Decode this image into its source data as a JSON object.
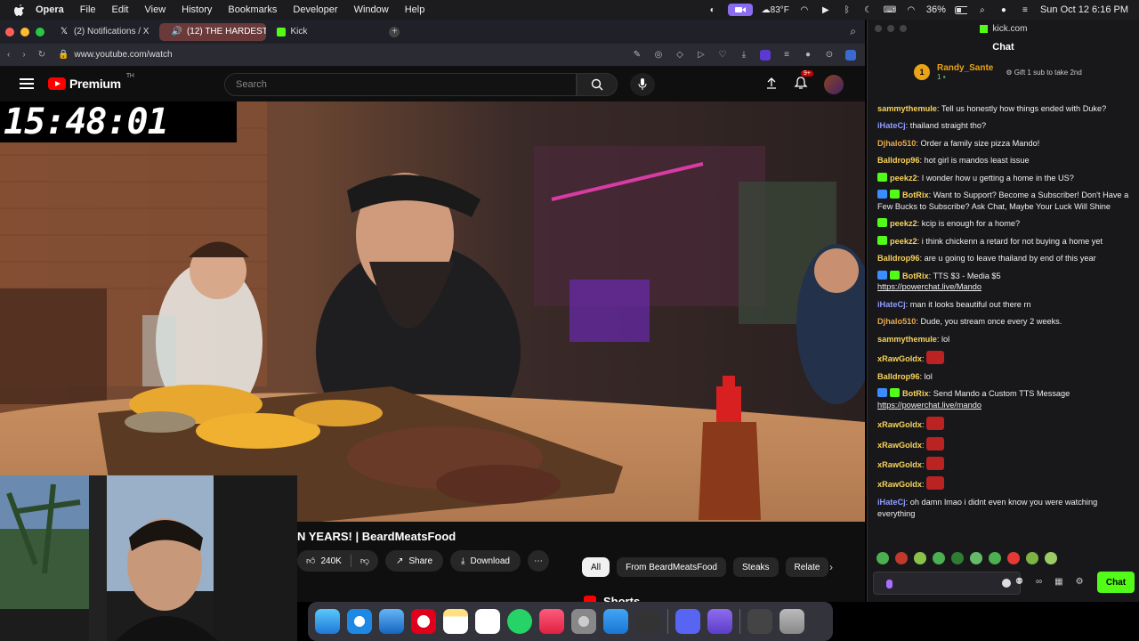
{
  "menubar": {
    "app_name": "Opera",
    "items": [
      "File",
      "Edit",
      "View",
      "History",
      "Bookmarks",
      "Developer",
      "Window",
      "Help"
    ],
    "weather": "83°F",
    "battery": "36%",
    "clock": "Sun Oct 12  6:16 PM"
  },
  "browser": {
    "tabs": [
      {
        "label": "(2) Notifications / X",
        "icon": "x-icon"
      },
      {
        "label": "(12) THE HARDEST",
        "icon": "youtube-icon"
      },
      {
        "label": "Kick",
        "icon": "kick-icon"
      }
    ],
    "url": "www.youtube.com/watch"
  },
  "youtube": {
    "logo_text": "Premium",
    "logo_sup": "TH",
    "search_placeholder": "Search",
    "notif_count": "9+",
    "video_title": "N YEARS! | BeardMeatsFood",
    "likes": "240K",
    "share_label": "Share",
    "download_label": "Download",
    "chips": [
      "All",
      "From BeardMeatsFood",
      "Steaks",
      "Relate"
    ],
    "shorts_label": "Shorts"
  },
  "overlay": {
    "timer": "15:48:01"
  },
  "chat": {
    "site": "kick.com",
    "title": "Chat",
    "pinned_user": "Randy_Sante",
    "pinned_rank": "1",
    "pinned_sub": "1",
    "gift_text": "Gift 1 sub to take 2nd",
    "messages": [
      {
        "user": "sammythemule",
        "color": "#f7d35a",
        "text": "Tell us honestly how things ended with Duke?"
      },
      {
        "user": "iHateCj",
        "color": "#8f9dff",
        "text": "thailand straight tho?"
      },
      {
        "user": "Djhalo510",
        "color": "#e8a94a",
        "text": "Order a family size pizza Mando!"
      },
      {
        "user": "Balldrop96",
        "color": "#f7d35a",
        "text": "hot girl is mandos least issue"
      },
      {
        "user": "peekz2",
        "color": "#f7d35a",
        "text": "I wonder how u getting a home in the US?",
        "badges": [
          "#53fc18"
        ]
      },
      {
        "user": "BotRix",
        "color": "#f7d35a",
        "text": "Want to Support? Become a Subscriber! Don't Have a Few Bucks to Subscribe? Ask Chat, Maybe Your Luck Will Shine",
        "badges": [
          "#3b8cff",
          "#53fc18"
        ]
      },
      {
        "user": "peekz2",
        "color": "#f7d35a",
        "text": "kcip is enough for a home?",
        "badges": [
          "#53fc18"
        ]
      },
      {
        "user": "peekz2",
        "color": "#f7d35a",
        "text": "i think chickenn a retard for not buying a home yet",
        "badges": [
          "#53fc18"
        ]
      },
      {
        "user": "Balldrop96",
        "color": "#f7d35a",
        "text": "are u going to leave thailand by end of this year"
      },
      {
        "user": "BotRix",
        "color": "#f7d35a",
        "text": "TTS $3 - Media $5",
        "link": "https://powerchat.live/Mando",
        "badges": [
          "#3b8cff",
          "#53fc18"
        ]
      },
      {
        "user": "iHateCj",
        "color": "#8f9dff",
        "text": "man it looks beautiful out there rn"
      },
      {
        "user": "Djhalo510",
        "color": "#e8a94a",
        "text": "Dude, you stream once every 2 weeks."
      },
      {
        "user": "sammythemule",
        "color": "#f7d35a",
        "text": "lol"
      },
      {
        "user": "xRawGoldx",
        "color": "#f7d35a",
        "text": "",
        "emote": true
      },
      {
        "user": "Balldrop96",
        "color": "#f7d35a",
        "text": "lol"
      },
      {
        "user": "BotRix",
        "color": "#f7d35a",
        "text": "Send Mando a Custom TTS Message",
        "link": "https://powerchat.live/mando",
        "badges": [
          "#3b8cff",
          "#53fc18"
        ]
      },
      {
        "user": "xRawGoldx",
        "color": "#f7d35a",
        "text": "",
        "emote": true
      },
      {
        "user": "xRawGoldx",
        "color": "#f7d35a",
        "text": "",
        "emote": true
      },
      {
        "user": "xRawGoldx",
        "color": "#f7d35a",
        "text": "",
        "emote": true
      },
      {
        "user": "xRawGoldx",
        "color": "#f7d35a",
        "text": "",
        "emote": true
      },
      {
        "user": "iHateCj",
        "color": "#8f9dff",
        "text": "oh damn lmao i didnt even know you were watching everything"
      }
    ],
    "send_label": "Chat"
  },
  "dock": {
    "apps": [
      "finder-icon",
      "safari-icon",
      "mail-icon",
      "opera-icon",
      "notes-icon",
      "reminders-icon",
      "whatsapp-icon",
      "music-icon",
      "settings-icon",
      "appstore-icon",
      "obs-icon",
      "discord-icon",
      "proton-mail-icon",
      "screenshot-icon",
      "trash-icon"
    ]
  }
}
